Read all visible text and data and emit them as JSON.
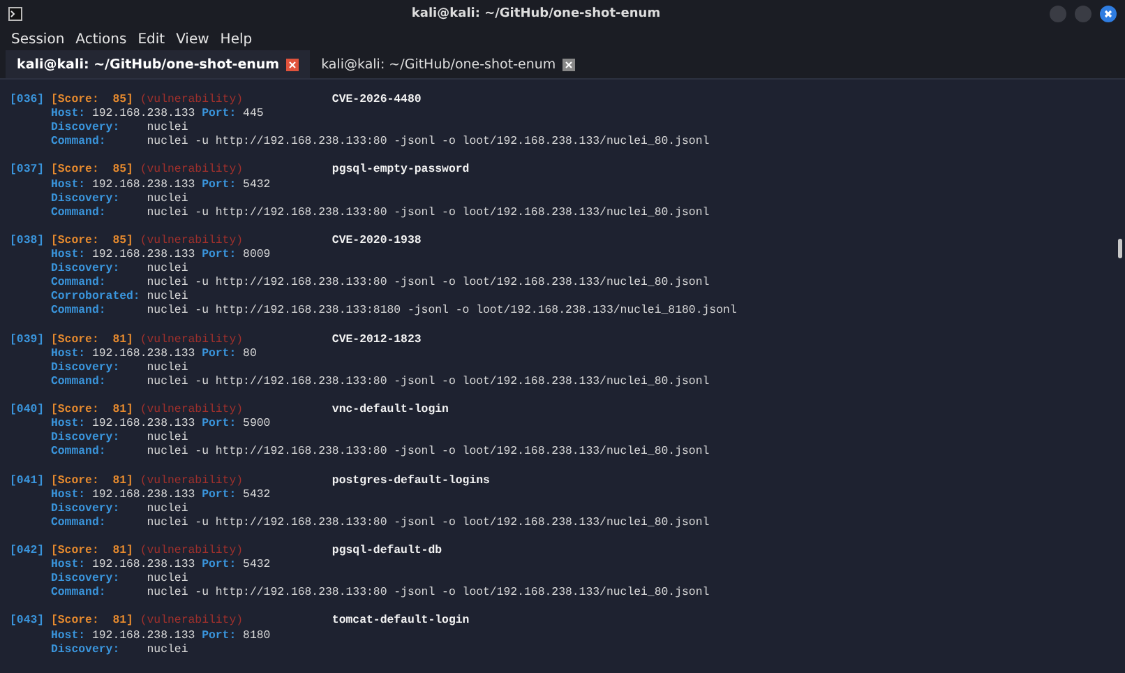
{
  "window": {
    "title": "kali@kali: ~/GitHub/one-shot-enum"
  },
  "menu": [
    "Session",
    "Actions",
    "Edit",
    "View",
    "Help"
  ],
  "tabs": [
    {
      "label": "kali@kali: ~/GitHub/one-shot-enum",
      "selected": true
    },
    {
      "label": "kali@kali: ~/GitHub/one-shot-enum",
      "selected": false
    }
  ],
  "entries": [
    {
      "id": "[036]",
      "score": "[Score:  85]",
      "tag": "(vulnerability)",
      "title": "CVE-2026-4480",
      "lines": [
        {
          "kind": "host",
          "label": "Host:",
          "value": "192.168.238.133",
          "port_label": "Port:",
          "port_value": "445"
        },
        {
          "kind": "plain",
          "label": "Discovery:",
          "value": "nuclei"
        },
        {
          "kind": "plain",
          "label": "Command:",
          "value": "nuclei -u http://192.168.238.133:80 -jsonl -o loot/192.168.238.133/nuclei_80.jsonl"
        }
      ]
    },
    {
      "id": "[037]",
      "score": "[Score:  85]",
      "tag": "(vulnerability)",
      "title": "pgsql-empty-password",
      "lines": [
        {
          "kind": "host",
          "label": "Host:",
          "value": "192.168.238.133",
          "port_label": "Port:",
          "port_value": "5432"
        },
        {
          "kind": "plain",
          "label": "Discovery:",
          "value": "nuclei"
        },
        {
          "kind": "plain",
          "label": "Command:",
          "value": "nuclei -u http://192.168.238.133:80 -jsonl -o loot/192.168.238.133/nuclei_80.jsonl"
        }
      ]
    },
    {
      "id": "[038]",
      "score": "[Score:  85]",
      "tag": "(vulnerability)",
      "title": "CVE-2020-1938",
      "lines": [
        {
          "kind": "host",
          "label": "Host:",
          "value": "192.168.238.133",
          "port_label": "Port:",
          "port_value": "8009"
        },
        {
          "kind": "plain",
          "label": "Discovery:",
          "value": "nuclei"
        },
        {
          "kind": "plain",
          "label": "Command:",
          "value": "nuclei -u http://192.168.238.133:80 -jsonl -o loot/192.168.238.133/nuclei_80.jsonl"
        },
        {
          "kind": "plain",
          "label": "Corroborated:",
          "value": "nuclei"
        },
        {
          "kind": "plain",
          "label": "Command:",
          "value": "nuclei -u http://192.168.238.133:8180 -jsonl -o loot/192.168.238.133/nuclei_8180.jsonl"
        }
      ]
    },
    {
      "id": "[039]",
      "score": "[Score:  81]",
      "tag": "(vulnerability)",
      "title": "CVE-2012-1823",
      "lines": [
        {
          "kind": "host",
          "label": "Host:",
          "value": "192.168.238.133",
          "port_label": "Port:",
          "port_value": "80"
        },
        {
          "kind": "plain",
          "label": "Discovery:",
          "value": "nuclei"
        },
        {
          "kind": "plain",
          "label": "Command:",
          "value": "nuclei -u http://192.168.238.133:80 -jsonl -o loot/192.168.238.133/nuclei_80.jsonl"
        }
      ]
    },
    {
      "id": "[040]",
      "score": "[Score:  81]",
      "tag": "(vulnerability)",
      "title": "vnc-default-login",
      "lines": [
        {
          "kind": "host",
          "label": "Host:",
          "value": "192.168.238.133",
          "port_label": "Port:",
          "port_value": "5900"
        },
        {
          "kind": "plain",
          "label": "Discovery:",
          "value": "nuclei"
        },
        {
          "kind": "plain",
          "label": "Command:",
          "value": "nuclei -u http://192.168.238.133:80 -jsonl -o loot/192.168.238.133/nuclei_80.jsonl"
        }
      ]
    },
    {
      "id": "[041]",
      "score": "[Score:  81]",
      "tag": "(vulnerability)",
      "title": "postgres-default-logins",
      "lines": [
        {
          "kind": "host",
          "label": "Host:",
          "value": "192.168.238.133",
          "port_label": "Port:",
          "port_value": "5432"
        },
        {
          "kind": "plain",
          "label": "Discovery:",
          "value": "nuclei"
        },
        {
          "kind": "plain",
          "label": "Command:",
          "value": "nuclei -u http://192.168.238.133:80 -jsonl -o loot/192.168.238.133/nuclei_80.jsonl"
        }
      ]
    },
    {
      "id": "[042]",
      "score": "[Score:  81]",
      "tag": "(vulnerability)",
      "title": "pgsql-default-db",
      "lines": [
        {
          "kind": "host",
          "label": "Host:",
          "value": "192.168.238.133",
          "port_label": "Port:",
          "port_value": "5432"
        },
        {
          "kind": "plain",
          "label": "Discovery:",
          "value": "nuclei"
        },
        {
          "kind": "plain",
          "label": "Command:",
          "value": "nuclei -u http://192.168.238.133:80 -jsonl -o loot/192.168.238.133/nuclei_80.jsonl"
        }
      ]
    },
    {
      "id": "[043]",
      "score": "[Score:  81]",
      "tag": "(vulnerability)",
      "title": "tomcat-default-login",
      "lines": [
        {
          "kind": "host",
          "label": "Host:",
          "value": "192.168.238.133",
          "port_label": "Port:",
          "port_value": "8180"
        },
        {
          "kind": "plain",
          "label": "Discovery:",
          "value": "nuclei"
        }
      ]
    }
  ]
}
